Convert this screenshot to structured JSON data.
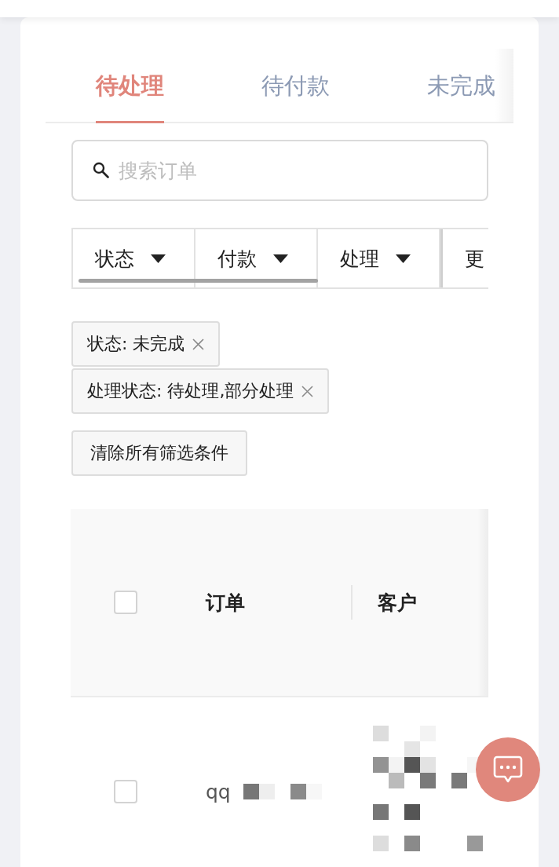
{
  "tabs": [
    {
      "label": "待处理",
      "selected": true
    },
    {
      "label": "待付款",
      "selected": false
    },
    {
      "label": "未完成",
      "selected": false
    }
  ],
  "search": {
    "placeholder": "搜索订单"
  },
  "filters": [
    {
      "kind": "dropdown",
      "label": "状态"
    },
    {
      "kind": "dropdown",
      "label": "付款"
    },
    {
      "kind": "dropdown",
      "label": "处理"
    },
    {
      "kind": "more",
      "label": "更"
    }
  ],
  "applied_filters": [
    {
      "label": "状态: 未完成"
    },
    {
      "label": "处理状态: 待处理,部分处理"
    }
  ],
  "clear_filters_button": {
    "label": "清除所有筛选条件"
  },
  "table": {
    "select_all": {
      "checked": false
    },
    "columns": [
      {
        "label": "订单"
      },
      {
        "label": "客户"
      }
    ],
    "rows": [
      {
        "checked": false,
        "order": "qq"
      }
    ]
  }
}
